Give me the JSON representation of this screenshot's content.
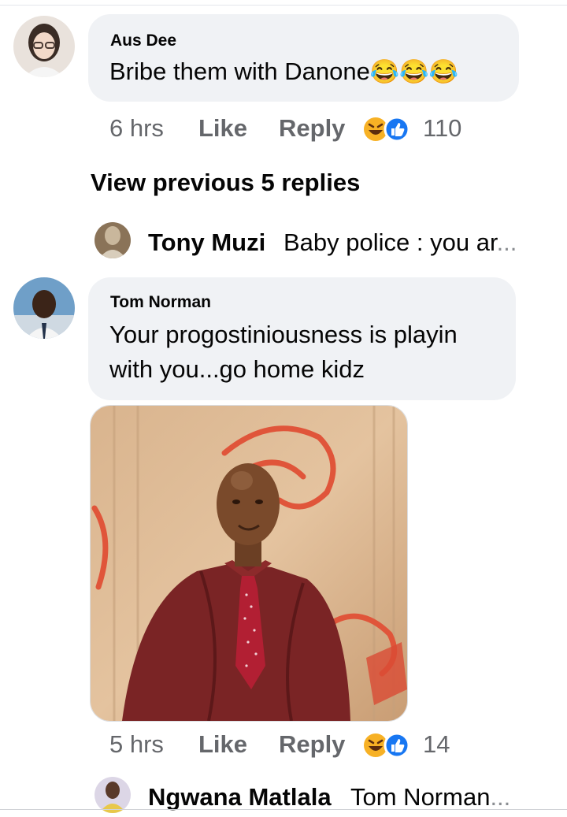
{
  "comments": [
    {
      "author": "Aus Dee",
      "text": "Bribe them with Danone",
      "emoji": "😂😂😂",
      "time": "6 hrs",
      "like": "Like",
      "reply": "Reply",
      "reaction_count": "110"
    },
    {
      "author": "Tom Norman",
      "text_line1": "Your progostiniousness is playin",
      "text_line2": "with you...go home kidz",
      "time": "5 hrs",
      "like": "Like",
      "reply": "Reply",
      "reaction_count": "14"
    }
  ],
  "view_previous": "View previous 5 replies",
  "replies": [
    {
      "author": "Tony Muzi",
      "snippet": "Baby police : you ar",
      "ellipsis": "..."
    },
    {
      "author": "Ngwana Matlala",
      "snippet": "Tom Norman",
      "ellipsis": "..."
    }
  ],
  "reaction_icons": [
    "laughing-face-icon",
    "thumbs-up-icon"
  ],
  "colors": {
    "bubble": "#f0f2f5",
    "meta_text": "#65676b",
    "like_blue": "#1877f2",
    "haha_yellow": "#f7b125"
  }
}
